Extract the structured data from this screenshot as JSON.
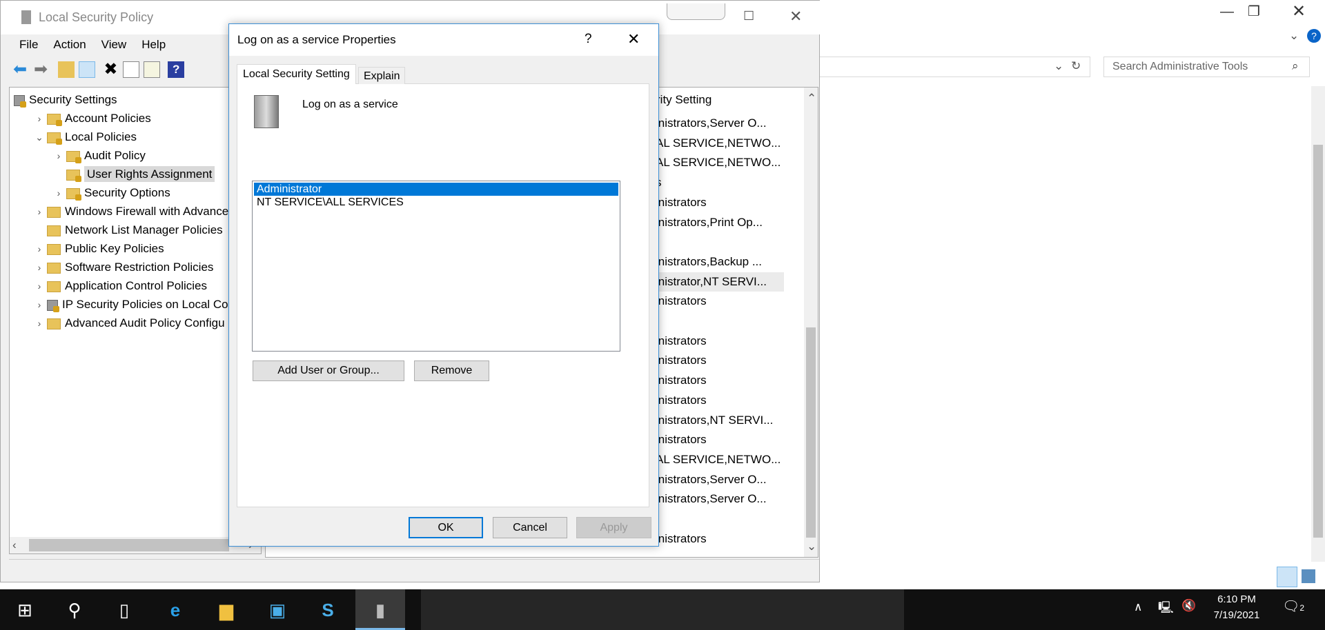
{
  "background_window": {
    "search_placeholder": "Search Administrative Tools"
  },
  "mmc": {
    "title": "Local Security Policy",
    "menu": [
      "File",
      "Action",
      "View",
      "Help"
    ],
    "tree": [
      {
        "label": "Security Settings",
        "chevron": "",
        "icon": "security-settings-icon",
        "indent": 0
      },
      {
        "label": "Account Policies",
        "chevron": "›",
        "icon": "folder-lock-icon",
        "indent": 1
      },
      {
        "label": "Local Policies",
        "chevron": "⌄",
        "icon": "folder-lock-icon",
        "indent": 1
      },
      {
        "label": "Audit Policy",
        "chevron": "›",
        "icon": "folder-lock-icon",
        "indent": 2
      },
      {
        "label": "User Rights Assignment",
        "chevron": "",
        "icon": "folder-lock-icon",
        "indent": 2,
        "selected": true
      },
      {
        "label": "Security Options",
        "chevron": "›",
        "icon": "folder-lock-icon",
        "indent": 2
      },
      {
        "label": "Windows Firewall with Advance",
        "chevron": "›",
        "icon": "folder-icon",
        "indent": 1
      },
      {
        "label": "Network List Manager Policies",
        "chevron": "",
        "icon": "folder-icon",
        "indent": 1
      },
      {
        "label": "Public Key Policies",
        "chevron": "›",
        "icon": "folder-icon",
        "indent": 1
      },
      {
        "label": "Software Restriction Policies",
        "chevron": "›",
        "icon": "folder-icon",
        "indent": 1
      },
      {
        "label": "Application Control Policies",
        "chevron": "›",
        "icon": "folder-icon",
        "indent": 1
      },
      {
        "label": "IP Security Policies on Local Cor",
        "chevron": "›",
        "icon": "ip-security-icon",
        "indent": 1
      },
      {
        "label": "Advanced Audit Policy Configu",
        "chevron": "›",
        "icon": "folder-icon",
        "indent": 1
      }
    ],
    "list_header": "rity Setting",
    "list_rows": [
      "inistrators,Server O...",
      "AL SERVICE,NETWO...",
      "AL SERVICE,NETWO...",
      "s",
      "inistrators",
      "inistrators,Print Op...",
      "",
      "inistrators,Backup ...",
      "inistrator,NT SERVI...",
      "inistrators",
      "",
      "inistrators",
      "inistrators",
      "inistrators",
      "inistrators",
      "inistrators,NT SERVI...",
      "inistrators",
      "AL SERVICE,NETWO...",
      "inistrators,Server O...",
      "inistrators,Server O...",
      "",
      "inistrators"
    ]
  },
  "dialog": {
    "title": "Log on as a service Properties",
    "help": "?",
    "close": "✕",
    "tabs": [
      "Local Security Setting",
      "Explain"
    ],
    "policy_name": "Log on as a service",
    "accounts": [
      "Administrator",
      "NT SERVICE\\ALL SERVICES"
    ],
    "add_button": "Add User or Group...",
    "remove_button": "Remove",
    "ok": "OK",
    "cancel": "Cancel",
    "apply": "Apply"
  },
  "taskbar": {
    "time": "6:10 PM",
    "date": "7/19/2021",
    "notifications": "2"
  }
}
